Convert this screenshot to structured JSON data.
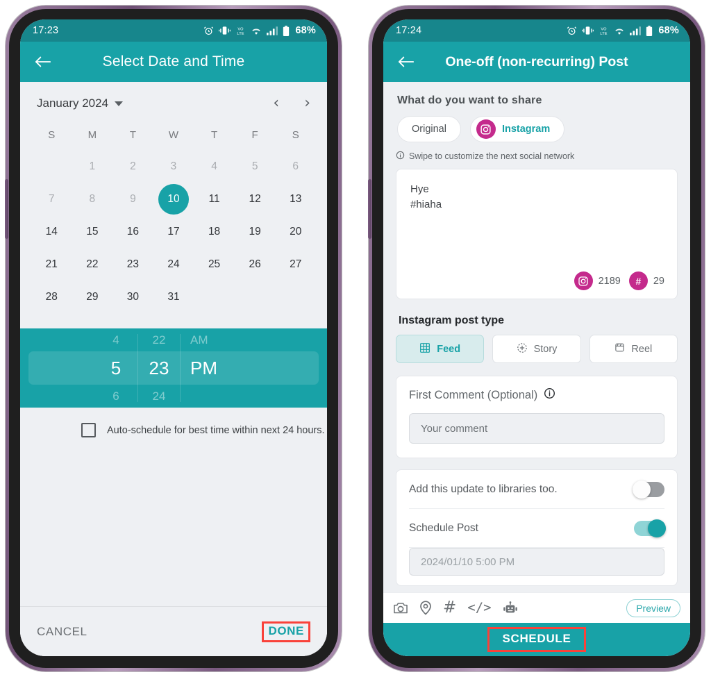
{
  "left_phone": {
    "status_bar": {
      "time": "17:23",
      "battery_percent": "68%",
      "icons": [
        "alarm-clock-icon",
        "vibrate-icon",
        "volte-icon",
        "wifi-icon",
        "signal-icon",
        "battery-icon"
      ]
    },
    "app_bar": {
      "back_icon": "arrow-left-icon",
      "title": "Select Date and Time"
    },
    "calendar": {
      "month_label": "January 2024",
      "prev_label": "‹",
      "next_label": "›",
      "day_headers": [
        "S",
        "M",
        "T",
        "W",
        "T",
        "F",
        "S"
      ],
      "weeks": [
        [
          {
            "d": "",
            "m": true
          },
          {
            "d": "1",
            "m": true
          },
          {
            "d": "2",
            "m": true
          },
          {
            "d": "3",
            "m": true
          },
          {
            "d": "4",
            "m": true
          },
          {
            "d": "5",
            "m": true
          },
          {
            "d": "6",
            "m": true
          }
        ],
        [
          {
            "d": "7",
            "m": true
          },
          {
            "d": "8",
            "m": true
          },
          {
            "d": "9",
            "m": true
          },
          {
            "d": "10",
            "m": false,
            "sel": true
          },
          {
            "d": "11",
            "m": false
          },
          {
            "d": "12",
            "m": false
          },
          {
            "d": "13",
            "m": false
          }
        ],
        [
          {
            "d": "14",
            "m": false
          },
          {
            "d": "15",
            "m": false
          },
          {
            "d": "16",
            "m": false
          },
          {
            "d": "17",
            "m": false
          },
          {
            "d": "18",
            "m": false
          },
          {
            "d": "19",
            "m": false
          },
          {
            "d": "20",
            "m": false
          }
        ],
        [
          {
            "d": "21",
            "m": false
          },
          {
            "d": "22",
            "m": false
          },
          {
            "d": "23",
            "m": false
          },
          {
            "d": "24",
            "m": false
          },
          {
            "d": "25",
            "m": false
          },
          {
            "d": "26",
            "m": false
          },
          {
            "d": "27",
            "m": false
          }
        ],
        [
          {
            "d": "28",
            "m": false
          },
          {
            "d": "29",
            "m": false
          },
          {
            "d": "30",
            "m": false
          },
          {
            "d": "31",
            "m": false
          },
          {
            "d": "",
            "m": false
          },
          {
            "d": "",
            "m": false
          },
          {
            "d": "",
            "m": false
          }
        ]
      ],
      "selected_day": "10"
    },
    "time_picker": {
      "hour_prev": "4",
      "hour_current": "5",
      "hour_next": "6",
      "minute_prev": "22",
      "minute_current": "23",
      "minute_next": "24",
      "ampm_prev": "AM",
      "ampm_current": "PM",
      "ampm_next": ""
    },
    "auto_schedule": {
      "checked": false,
      "label": "Auto-schedule for best time within next 24 hours."
    },
    "footer": {
      "cancel_label": "CANCEL",
      "done_label": "DONE"
    }
  },
  "right_phone": {
    "status_bar": {
      "time": "17:24",
      "battery_percent": "68%",
      "icons": [
        "alarm-clock-icon",
        "vibrate-icon",
        "volte-icon",
        "wifi-icon",
        "signal-icon",
        "battery-icon"
      ]
    },
    "app_bar": {
      "back_icon": "arrow-left-icon",
      "title": "One-off (non-recurring) Post"
    },
    "share_section": {
      "title": "What do you want to share",
      "tabs": [
        {
          "label": "Original",
          "active": false,
          "icon": null
        },
        {
          "label": "Instagram",
          "active": true,
          "icon": "instagram-icon"
        }
      ],
      "hint_icon": "info-icon",
      "hint": "Swipe to customize the next social network"
    },
    "composer": {
      "line1": "Hye",
      "line2": "#hiaha",
      "char_counter": "2189",
      "char_icon": "instagram-icon",
      "hashtag_counter": "29",
      "hashtag_icon": "hash-icon"
    },
    "post_type": {
      "title": "Instagram post type",
      "options": [
        {
          "label": "Feed",
          "icon": "grid-icon",
          "active": true
        },
        {
          "label": "Story",
          "icon": "story-plus-icon",
          "active": false
        },
        {
          "label": "Reel",
          "icon": "reel-icon",
          "active": false
        }
      ]
    },
    "first_comment": {
      "title": "First Comment (Optional)",
      "info_icon": "info-circle-icon",
      "placeholder": "Your comment",
      "value": ""
    },
    "options": [
      {
        "label": "Add this update to libraries too.",
        "enabled": false
      },
      {
        "label": "Schedule Post",
        "enabled": true
      }
    ],
    "schedule_field_value": "2024/01/10 5:00 PM",
    "toolbar": {
      "icons": [
        "camera-icon",
        "location-pin-icon",
        "hashtag-icon",
        "code-icon",
        "robot-icon"
      ],
      "hashtag_glyph": "#",
      "code_glyph": "</>",
      "preview_label": "Preview"
    },
    "footer": {
      "schedule_label": "SCHEDULE"
    }
  },
  "theme": {
    "teal": "#18a2a7",
    "teal_dark": "#17868c",
    "magenta": "#c42a8c",
    "highlight_red": "#f9423a",
    "screen_bg": "#eef0f3"
  }
}
